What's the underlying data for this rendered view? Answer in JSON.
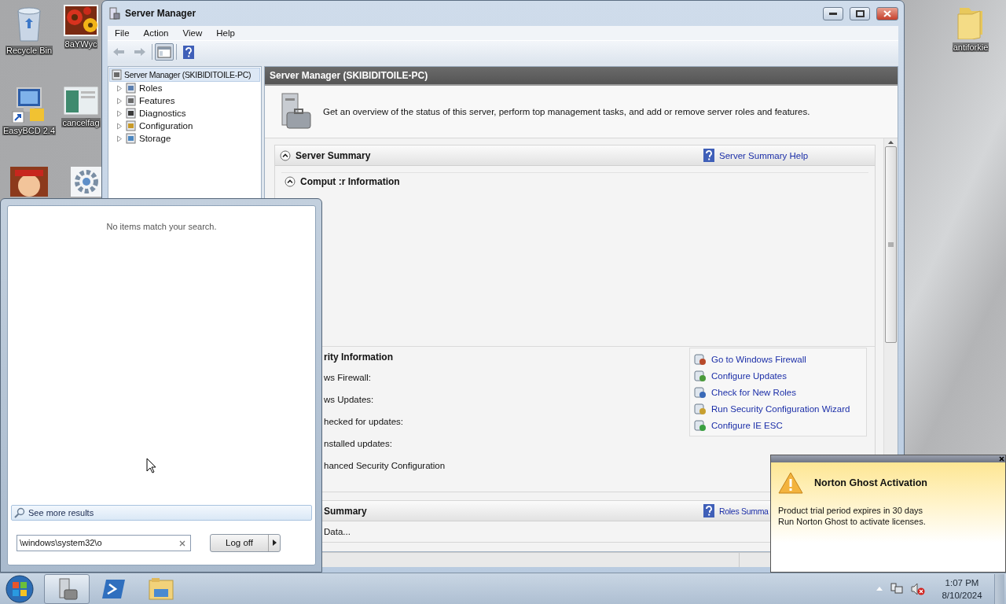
{
  "desktop": {
    "icons": [
      {
        "kind": "recycle-bin",
        "label": "Recycle Bin"
      },
      {
        "label": "8aYWyc"
      },
      {
        "kind": "shortcut",
        "label": "EasyBCD 2.4"
      },
      {
        "kind": "document",
        "label": "cancelfag"
      },
      {
        "kind": "figure"
      },
      {
        "kind": "gear"
      },
      {
        "kind": "folder",
        "label": "antiforkie"
      }
    ]
  },
  "server_manager": {
    "title": "Server Manager",
    "menu": [
      "File",
      "Action",
      "View",
      "Help"
    ],
    "toolbar": [
      {
        "kind": "back",
        "disabled": true
      },
      {
        "kind": "forward",
        "disabled": true
      },
      {
        "kind": "console-tree",
        "pressed": true
      },
      {
        "kind": "help",
        "pressed": false
      }
    ],
    "tree": {
      "label": "Server Manager (SKIBIDITOILE-PC)",
      "selected": true,
      "children": [
        {
          "label": "Roles",
          "kind": "roles",
          "expanded": false
        },
        {
          "label": "Features",
          "kind": "features",
          "expanded": false
        },
        {
          "label": "Diagnostics",
          "kind": "diagnostics",
          "expanded": false
        },
        {
          "label": "Configuration",
          "kind": "configuration",
          "expanded": false
        },
        {
          "label": "Storage",
          "kind": "storage",
          "expanded": false
        }
      ]
    },
    "header": "Server Manager (SKIBIDITOILE-PC)",
    "intro": "Get an overview of the status of this server, perform top management tasks, and add or remove server roles and features.",
    "server_summary": {
      "title": "Server Summary",
      "expanded": true,
      "help_link": "Server Summary Help",
      "computer_information": {
        "title": "Comput :r Information",
        "expanded": true
      },
      "security_information": {
        "title": "rity Information",
        "fields": [
          "ws Firewall:",
          "ws Updates:",
          "hecked for updates:",
          "nstalled updates:",
          "hanced Security Configuration"
        ],
        "tasks": [
          {
            "kind": "firewall",
            "label": "Go to Windows Firewall"
          },
          {
            "kind": "updates",
            "label": "Configure Updates"
          },
          {
            "kind": "roles",
            "label": "Check for New Roles"
          },
          {
            "kind": "security",
            "label": "Run Security Configuration Wizard"
          },
          {
            "kind": "ie-esc",
            "label": "Configure IE ESC"
          }
        ]
      }
    },
    "roles_summary": {
      "title": "Summary",
      "help_link": "Roles Summa",
      "rows": [
        "Data..."
      ]
    }
  },
  "start_menu": {
    "message": "No items match your search.",
    "see_more": "See more results",
    "search_value": "\\windows\\system32\\o",
    "shutdown_label": "Log off"
  },
  "notification": {
    "title": "Norton Ghost Activation",
    "lines": [
      "Product trial period expires in 30 days",
      "Run Norton Ghost to activate licenses."
    ]
  },
  "taskbar": {
    "apps": [
      {
        "kind": "server-manager",
        "selected": true
      },
      {
        "kind": "powershell",
        "selected": false
      },
      {
        "kind": "explorer",
        "selected": false
      }
    ],
    "clock": {
      "time": "1:07 PM",
      "date": "8/10/2024"
    }
  }
}
